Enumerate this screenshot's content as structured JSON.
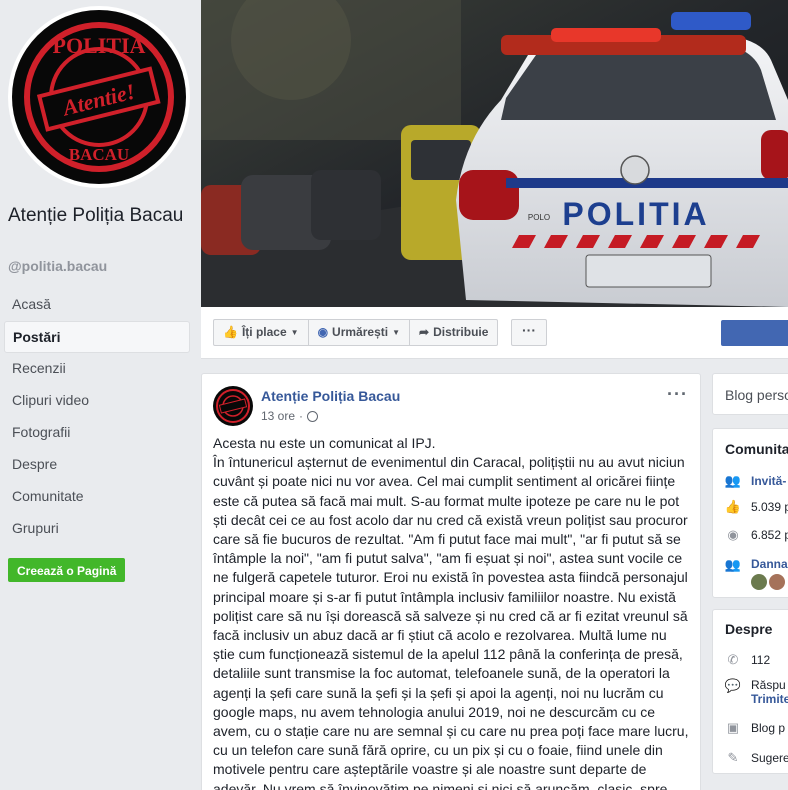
{
  "sidebar": {
    "logo_text_top": "POLITIA",
    "logo_text_center": "Atentie!",
    "logo_text_bottom": "BACAU",
    "page_name": "Atenție Poliția Bacau",
    "handle": "@politia.bacau",
    "nav": [
      "Acasă",
      "Postări",
      "Recenzii",
      "Clipuri video",
      "Fotografii",
      "Despre",
      "Comunitate",
      "Grupuri"
    ],
    "active_nav": "Postări",
    "create_page": "Creează o Pagină"
  },
  "cover": {
    "car_text": "POLITIA",
    "car_small_text": "POLO"
  },
  "actions": {
    "like": "Îți place",
    "follow": "Urmărești",
    "share": "Distribuie",
    "more": "···"
  },
  "post": {
    "author": "Atenție Poliția Bacau",
    "time": "13 ore",
    "separator": "·",
    "options": "···",
    "paragraphs": [
      "Acesta nu este un comunicat al IPJ.",
      "În întunericul așternut de evenimentul din Caracal, polițiștii nu au avut niciun cuvânt și poate nici nu vor avea. Cel mai cumplit sentiment al oricărei ființe este că putea să facă mai mult. S-au format multe ipoteze pe care nu le pot ști decât cei ce au fost acolo dar nu cred că există vreun polițist sau procuror care să fie bucuros de rezultat. \"Am fi putut face mai mult\", \"ar fi putut să se întâmple la noi\", \"am fi putut salva\", \"am fi eșuat și noi\", astea sunt vocile ce ne fulgeră capetele tuturor. Eroi nu există în povestea asta fiindcă personajul principal moare și s-ar fi putut întâmpla inclusiv familiilor noastre. Nu există polițist care să nu își dorească să salveze și nu cred că ar fi ezitat vreunul să facă inclusiv un abuz dacă ar fi știut că acolo e rezolvarea. Multă lume nu știe cum funcționează sistemul de la apelul 112 până la conferința de presă, detaliile sunt transmise la foc automat, telefoanele sună, de la operatori la agenți la șefi care sună la șefi și la șefi și apoi la agenți, noi nu lucrăm cu google maps, nu avem tehnologia anului 2019, noi ne descurcăm cu ce avem, cu o stație care nu are semnal și cu care nu prea poți face mare lucru, cu un telefon care sună fără oprire, cu un pix și cu o foaie, fiind unele din motivele pentru care așteptările voastre și ale noastre sunt departe de adevăr. Nu vrem să învinovățim pe nimeni și nici să aruncăm, clasic, spre"
    ]
  },
  "right": {
    "blog": "Blog perso",
    "community_title": "Comunita",
    "invite": "Invită-",
    "likes": "5.039 p",
    "follows": "6.852 p",
    "friend": "Danna",
    "about_title": "Despre",
    "phone": "112",
    "reply": "Răspu",
    "send": "Trimite",
    "blog_short": "Blog p",
    "suggest": "Sugere"
  },
  "colors": {
    "background": "#e9ebee",
    "link_blue": "#365899",
    "brand_blue": "#4267b2",
    "create_green": "#42b72a",
    "logo_red": "#d0202a"
  }
}
